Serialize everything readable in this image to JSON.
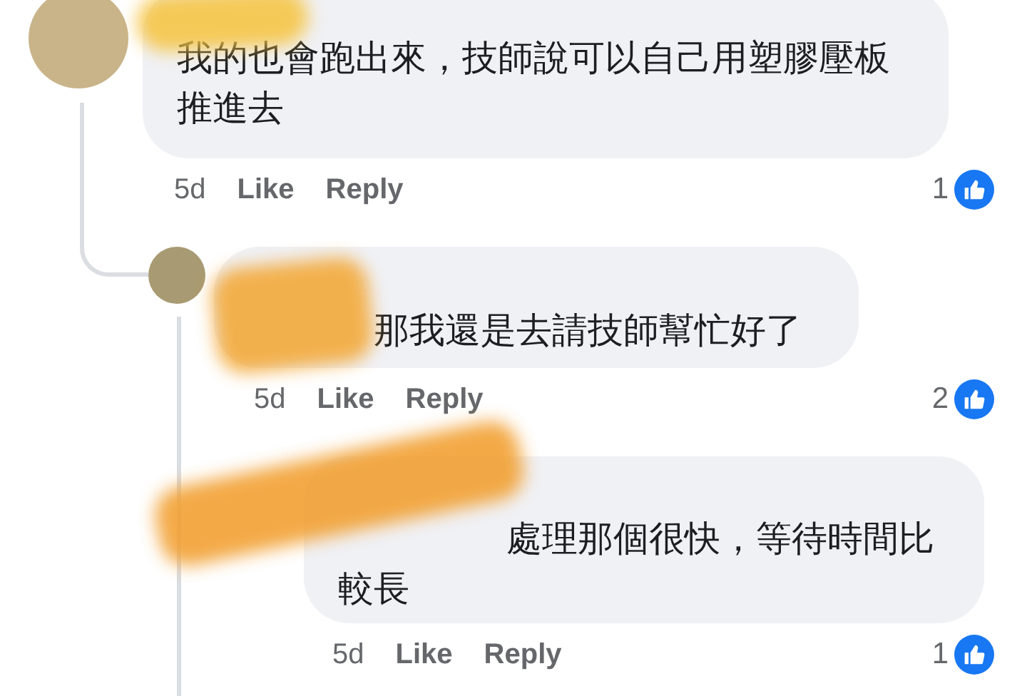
{
  "comments": [
    {
      "name_redacted": true,
      "avatar": true,
      "text": "我的也會跑出來，技師說可以自己用塑膠壓板推進去",
      "time": "5d",
      "like": "Like",
      "reply": "Reply",
      "reactions": "1",
      "children": [
        {
          "name_redacted": true,
          "avatar": true,
          "mention_hidden": true,
          "text": "那我還是去請技師幫忙好了",
          "time": "5d",
          "like": "Like",
          "reply": "Reply",
          "reactions": "2",
          "children": [
            {
              "name_redacted": true,
              "mention_hidden": true,
              "text": "處理那個很快，等待時間比較長",
              "time": "5d",
              "like": "Like",
              "reply": "Reply",
              "reactions": "1"
            }
          ]
        }
      ]
    }
  ]
}
